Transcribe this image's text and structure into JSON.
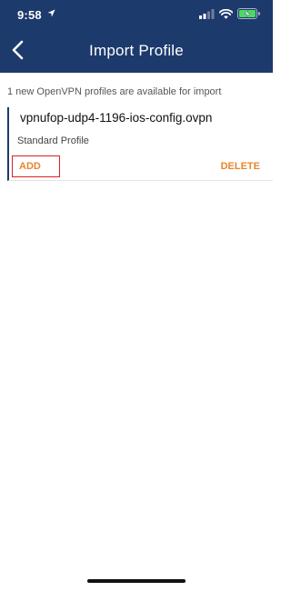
{
  "status_bar": {
    "time": "9:58",
    "location_icon": "location-arrow-icon",
    "signal_icon": "cellular-signal-icon",
    "wifi_icon": "wifi-icon",
    "battery_icon": "battery-charging-icon",
    "battery_color": "#4cd964"
  },
  "header": {
    "title": "Import Profile",
    "back_icon": "chevron-left-icon",
    "background_color": "#1d3a6c"
  },
  "main": {
    "info_text": "1 new OpenVPN profiles are available for import",
    "profile": {
      "filename": "vpnufop-udp4-1196-ios-config.ovpn",
      "type": "Standard Profile",
      "add_label": "ADD",
      "delete_label": "DELETE",
      "action_color": "#e8862d",
      "highlight_color": "#d92027"
    }
  }
}
